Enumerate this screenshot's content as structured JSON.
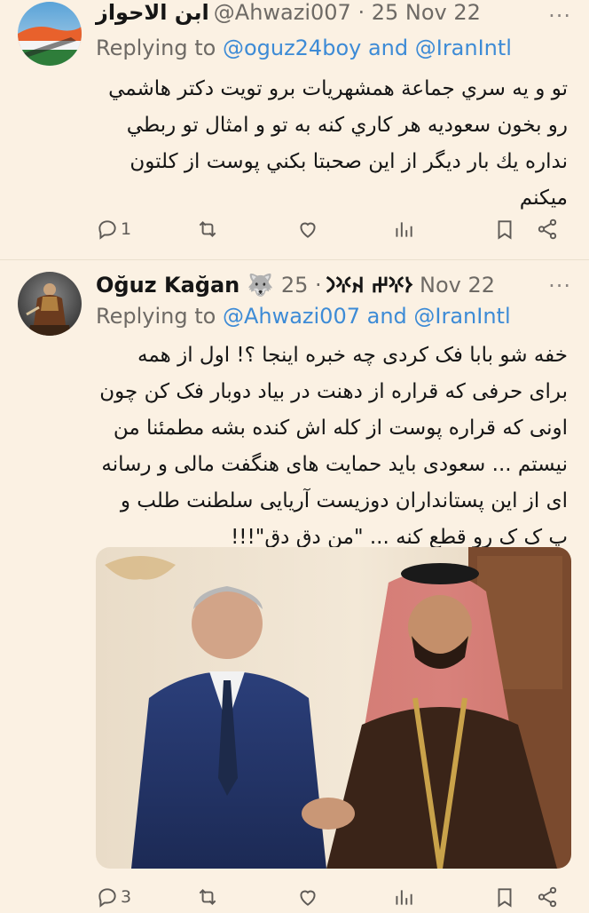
{
  "colors": {
    "background": "#fbf1e3",
    "mention": "#3d8bd6",
    "muted": "#6e6a65"
  },
  "tweets": [
    {
      "display_name": "ابن الاحواز",
      "meta": "@Ahwazi007 · 25 Nov 22",
      "replying_prefix": "Replying to ",
      "replying_mentions": "@oguz24boy and @IranIntl",
      "more": "···",
      "body": "تو و يه سري جماعة همشهريات برو تويت دكتر هاشمي رو بخون سعوديه هر كاري كنه به تو و امثال تو ربطي نداره يك بار ديگر از اين صحبتا بكني پوست از كلتون ميكنم",
      "replies": "1",
      "retweets": "",
      "likes": "",
      "icons": [
        "reply-icon",
        "retweet-icon",
        "like-icon",
        "views-icon",
        "bookmark-icon",
        "share-icon"
      ]
    },
    {
      "display_name": "Oğuz Kağan 🐺 𐰆𐰍𐰔 𐰴𐰍𐰣",
      "meta": "· 25 Nov 22",
      "replying_prefix": "Replying to ",
      "replying_mentions": "@Ahwazi007 and @IranIntl",
      "more": "···",
      "body": "خفه شو بابا فک کردی چه خبره اینجا ؟! اول از همه برای حرفی که قراره از دهنت در بیاد دوبار فک کن چون اونی که قراره پوست از کله اش کنده بشه مطمئنا من نیستم ... سعودی باید حمایت های هنگفت مالی و رسانه ای از این پستانداران دوزیست آریایی سلطنت طلب و پ ک ک رو قطع کنه ... \"من دق دق\"!!!",
      "replies": "3",
      "retweets": "",
      "likes": "",
      "icons": [
        "reply-icon",
        "retweet-icon",
        "like-icon",
        "views-icon",
        "bookmark-icon",
        "share-icon"
      ]
    }
  ]
}
